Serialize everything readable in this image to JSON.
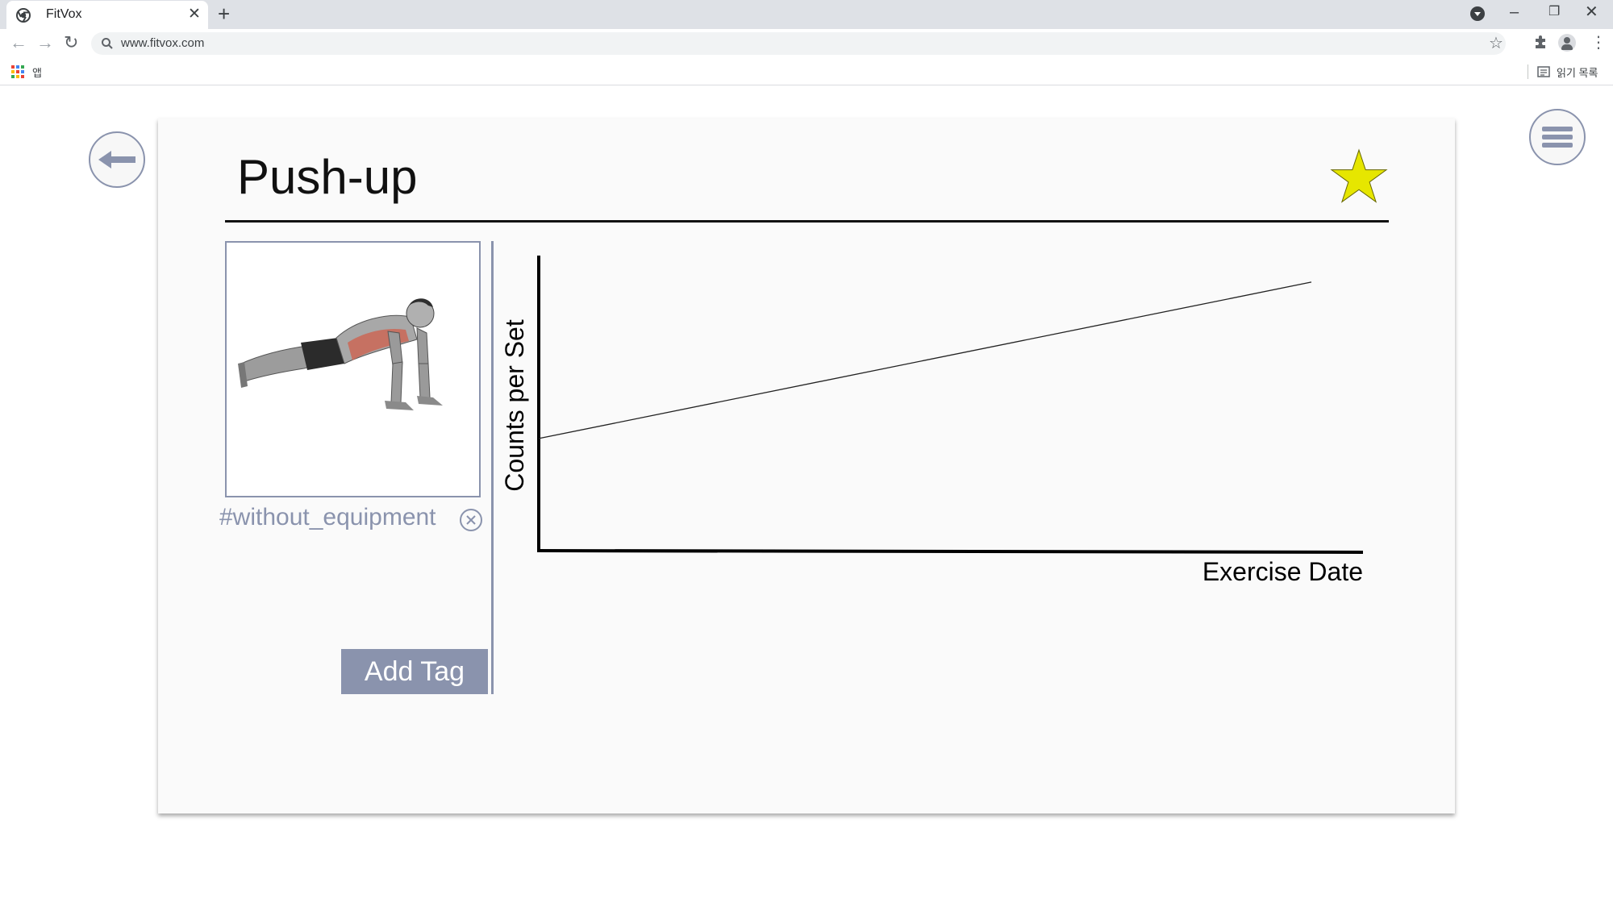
{
  "browser": {
    "tab_title": "FitVox",
    "new_tab": "+",
    "tab_close": "✕",
    "url": "www.fitvox.com",
    "bookmarks": {
      "apps_label": "앱",
      "reading_list_label": "읽기 목록"
    }
  },
  "page": {
    "title": "Push-up",
    "favorite": true,
    "accent_color": "#8a93ad",
    "star_color": "#e6e600",
    "tag": "#without_equipment",
    "add_tag_label": "Add Tag"
  },
  "chart_data": {
    "type": "line",
    "xlabel": "Exercise Date",
    "ylabel": "Counts per Set",
    "x_ticks": [],
    "y_ticks": [],
    "grid": false,
    "series": [
      {
        "values": [
          0.38,
          0.91
        ]
      }
    ],
    "ylim": [
      0,
      1
    ]
  }
}
